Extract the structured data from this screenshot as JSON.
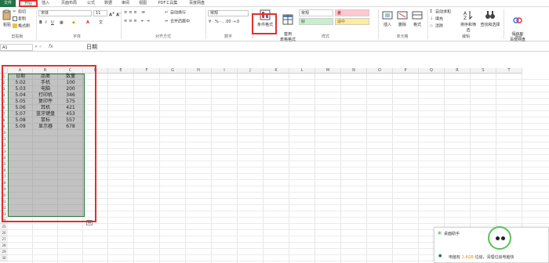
{
  "tabs": [
    "文件",
    "开始",
    "插入",
    "页面布局",
    "公式",
    "数据",
    "审阅",
    "视图",
    "PDF工具集",
    "百度网盘"
  ],
  "ribbon": {
    "clipboard": {
      "cut": "剪切",
      "copy": "复制",
      "painter": "格式刷",
      "label": "剪贴板",
      "paste": "粘贴"
    },
    "font": {
      "name": "宋体",
      "size": "11",
      "label": "字体"
    },
    "align": {
      "wrap": "自动换行",
      "merge": "合并后居中",
      "label": "对齐方式"
    },
    "number": {
      "format": "常规",
      "label": "数字"
    },
    "cond_format": "条件格式",
    "table_format": "套用\n表格格式",
    "styles": {
      "label": "样式",
      "cells": [
        "常规",
        "差",
        "好",
        "适中"
      ]
    },
    "cells": {
      "insert": "插入",
      "delete": "删除",
      "format": "格式",
      "label": "单元格"
    },
    "editing": {
      "autosum": "自动求和",
      "fill": "填充",
      "clear": "清除",
      "sort": "排序和筛选",
      "find": "查找和选择",
      "label": "编辑"
    },
    "save": {
      "btn": "保存到\n百度网盘",
      "label": "保存"
    }
  },
  "formula_bar": {
    "name_box": "A1",
    "fx": "fx",
    "value": "日期"
  },
  "columns": [
    "A",
    "B",
    "C",
    "D",
    "E",
    "F",
    "G",
    "H",
    "I",
    "J",
    "K",
    "L",
    "M",
    "N",
    "O",
    "P",
    "Q",
    "R",
    "S",
    "T"
  ],
  "rows": [
    "1",
    "2",
    "3",
    "4",
    "5",
    "6",
    "7",
    "8",
    "9",
    "10",
    "11",
    "12",
    "13",
    "14",
    "15",
    "16",
    "17",
    "18",
    "19",
    "20",
    "21",
    "22",
    "23",
    "24",
    "25",
    "26",
    "27",
    "28",
    "29",
    "30"
  ],
  "table": {
    "headers": [
      "日期",
      "品类",
      "数量"
    ],
    "rows": [
      [
        "5.02",
        "手机",
        "100"
      ],
      [
        "5.03",
        "电脑",
        "200"
      ],
      [
        "5.04",
        "打印机",
        "346"
      ],
      [
        "5.05",
        "复印件",
        "575"
      ],
      [
        "5.06",
        "耳机",
        "421"
      ],
      [
        "5.07",
        "蓝牙键盘",
        "453"
      ],
      [
        "5.08",
        "鼠标",
        "557"
      ],
      [
        "5.09",
        "显示器",
        "678"
      ]
    ]
  },
  "notification": {
    "title": "桌面助手",
    "msg_pre": "电脑有 ",
    "msg_hl": "2.6GB",
    "msg_post": " 垃圾，清理垃圾电脑快"
  }
}
